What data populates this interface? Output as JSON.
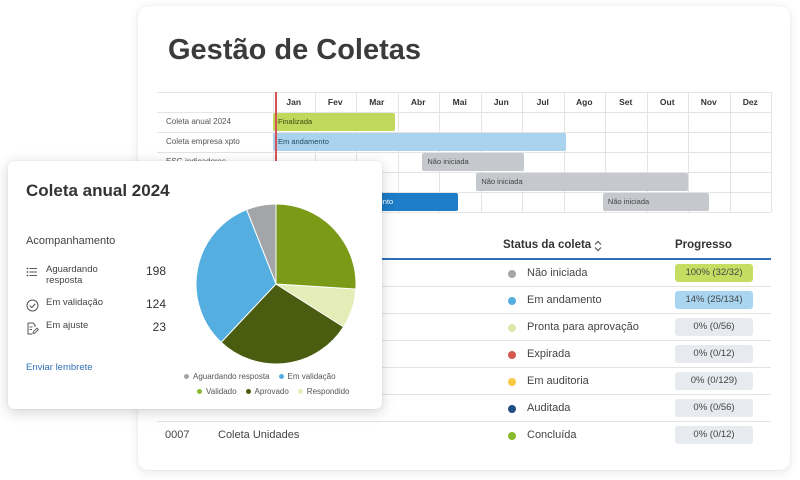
{
  "page": {
    "title": "Gestão de Coletas"
  },
  "gantt": {
    "months": [
      "Jan",
      "Fev",
      "Mar",
      "Abr",
      "Mai",
      "Jun",
      "Jul",
      "Ago",
      "Set",
      "Out",
      "Nov",
      "Dez"
    ],
    "rows": [
      {
        "label": "Coleta anual 2024"
      },
      {
        "label": "Coleta empresa xpto"
      },
      {
        "label": "ESG indicadores"
      },
      {
        "label": ""
      },
      {
        "label": ""
      }
    ],
    "bars": [
      {
        "row": 0,
        "start": 0.0,
        "end": 2.95,
        "label": "Finalizada",
        "color": "#c1d85d",
        "text_color": "#3e4a10"
      },
      {
        "row": 1,
        "start": 0.0,
        "end": 7.05,
        "label": "Em andamento",
        "color": "#a8d2ee",
        "text_color": "#2a4a60"
      },
      {
        "row": 2,
        "start": 3.6,
        "end": 6.05,
        "label": "Não iniciada",
        "color": "#c5c8cd",
        "text_color": "#444444"
      },
      {
        "row": 3,
        "start": 4.9,
        "end": 10.0,
        "label": "Não iniciada",
        "color": "#c5c8cd",
        "text_color": "#444444"
      },
      {
        "row": 4,
        "start": 1.55,
        "end": 4.45,
        "label": "Em andamento",
        "color": "#1e7cc8",
        "text_color": "#ffffff"
      },
      {
        "row": 4,
        "start": 7.95,
        "end": 10.5,
        "label": "Não iniciada",
        "color": "#c5c8cd",
        "text_color": "#444444"
      }
    ]
  },
  "table": {
    "status_header": "Status da coleta",
    "progress_header": "Progresso",
    "rows": [
      {
        "id": "",
        "name": "",
        "status": "Não iniciada",
        "dot": "#a3a5a8",
        "progress": "100%  (32/32)",
        "progress_bg": "#c5de62"
      },
      {
        "id": "",
        "name": "",
        "status": "Em andamento",
        "dot": "#55aee0",
        "progress": "14%  (25/134)",
        "progress_bg": "#a9d5f1"
      },
      {
        "id": "",
        "name": "",
        "status": "Pronta para aprovação",
        "dot": "#dfeaaa",
        "progress": "0%  (0/56)",
        "progress_bg": "#e7eaee"
      },
      {
        "id": "",
        "name": "",
        "status": "Expirada",
        "dot": "#d25a4e",
        "progress": "0%  (0/12)",
        "progress_bg": "#e7eaee"
      },
      {
        "id": "",
        "name": "",
        "status": "Em auditoria",
        "dot": "#f6c844",
        "progress": "0%  (0/129)",
        "progress_bg": "#e7eaee"
      },
      {
        "id": "",
        "name": "",
        "status": "Auditada",
        "dot": "#1f4f86",
        "progress": "0%  (0/56)",
        "progress_bg": "#e7eaee"
      },
      {
        "id": "0007",
        "name": "Coleta Unidades",
        "status": "Concluída",
        "dot": "#8ab92d",
        "progress": "0%  (0/12)",
        "progress_bg": "#e7eaee"
      }
    ]
  },
  "popup": {
    "title": "Coleta anual 2024",
    "subtitle": "Acompanhamento",
    "metrics": [
      {
        "label": "Aguardando resposta",
        "value": "198",
        "icon": "list-icon"
      },
      {
        "label": "Em validação",
        "value": "124",
        "icon": "check-circle-icon"
      },
      {
        "label": "Em ajuste",
        "value": "23",
        "icon": "edit-icon"
      }
    ],
    "reminder_link": "Enviar lembrete",
    "pie": [
      {
        "name": "Aguardando resposta",
        "value": 6,
        "color": "#a3a5a8"
      },
      {
        "name": "Em validação",
        "value": 32,
        "color": "#55aee0"
      },
      {
        "name": "Aprovado",
        "value": 28,
        "color": "#4a5c10"
      },
      {
        "name": "Respondido",
        "value": 8,
        "color": "#e4edb8"
      },
      {
        "name": "Validado",
        "value": 26,
        "color": "#7a9a18"
      }
    ],
    "legend": [
      [
        {
          "name": "Aguardando resposta",
          "color": "#a3a5a8"
        },
        {
          "name": "Em validação",
          "color": "#55aee0"
        }
      ],
      [
        {
          "name": "Validado",
          "color": "#8ab92d"
        },
        {
          "name": "Aprovado",
          "color": "#4a5c10"
        },
        {
          "name": "Respondido",
          "color": "#e4edb8"
        }
      ]
    ]
  }
}
